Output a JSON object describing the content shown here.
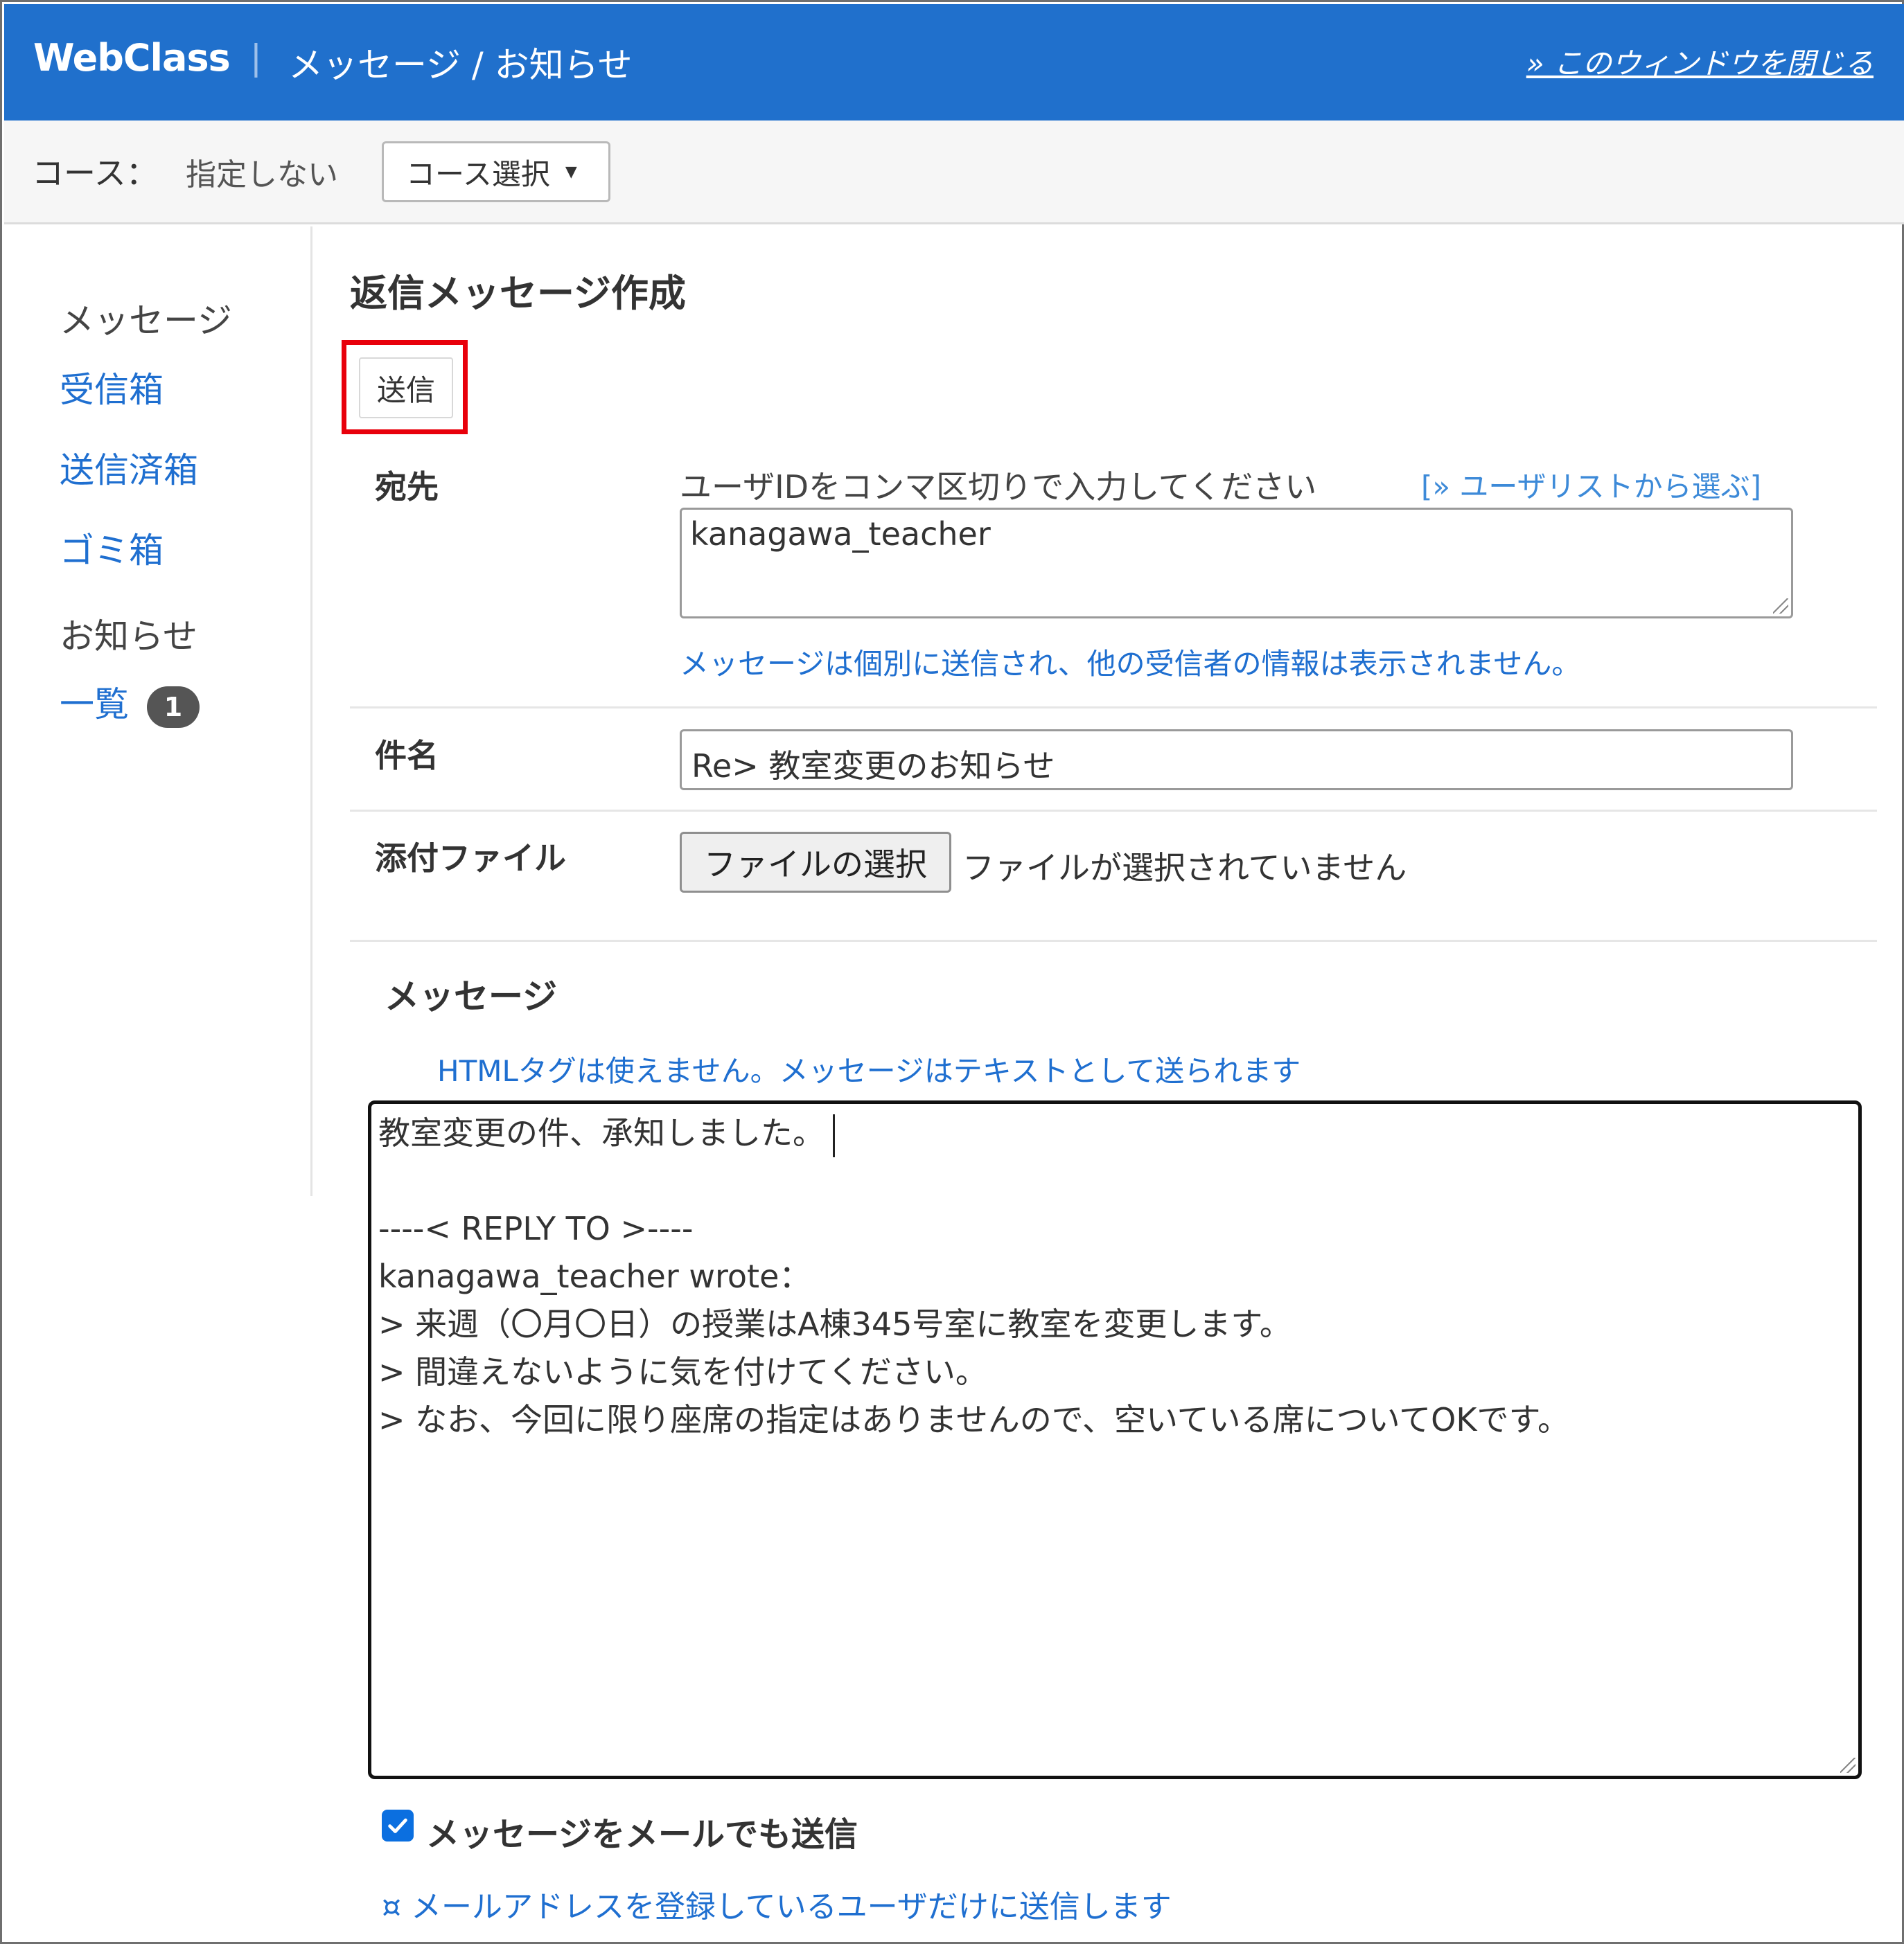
{
  "header": {
    "brand": "WebClass",
    "separator": "|",
    "title": "メッセージ / お知らせ",
    "close_link": "» このウィンドウを閉じる"
  },
  "course_bar": {
    "label": "コース：",
    "value": "指定しない",
    "select_label": "コース選択",
    "select_caret": "▼"
  },
  "sidebar": {
    "messages_heading": "メッセージ",
    "inbox": "受信箱",
    "sent": "送信済箱",
    "trash": "ゴミ箱",
    "notices_heading": "お知らせ",
    "list": "一覧",
    "list_badge": "1"
  },
  "main": {
    "title": "返信メッセージ作成",
    "send_button": "送信",
    "to": {
      "label": "宛先",
      "hint": "ユーザIDをコンマ区切りで入力してください",
      "pick_link": "[» ユーザリストから選ぶ]",
      "value": "kanagawa_teacher",
      "note": "メッセージは個別に送信され、他の受信者の情報は表示されません。"
    },
    "subject": {
      "label": "件名",
      "value": "Re> 教室変更のお知らせ"
    },
    "attachment": {
      "label": "添付ファイル",
      "button": "ファイルの選択",
      "status": "ファイルが選択されていません"
    },
    "message": {
      "heading": "メッセージ",
      "note": "HTMLタグは使えません。メッセージはテキストとして送られます",
      "lines": [
        "教室変更の件、承知しました。",
        "",
        "----< REPLY TO >----",
        "kanagawa_teacher wrote：",
        "> 来週（〇月〇日）の授業はA棟345号室に教室を変更します。",
        "> 間違えないように気を付けてください。",
        "> なお、今回に限り座席の指定はありませんので、空いている席についてOKです。"
      ]
    },
    "email_option": {
      "checked": true,
      "label": "メッセージをメールでも送信",
      "note": "¤ メールアドレスを登録しているユーザだけに送信します"
    }
  },
  "colors": {
    "header_bg": "#2070cc",
    "link": "#1f6fd0",
    "highlight": "#e8000b",
    "checkbox": "#0b6fe0"
  }
}
